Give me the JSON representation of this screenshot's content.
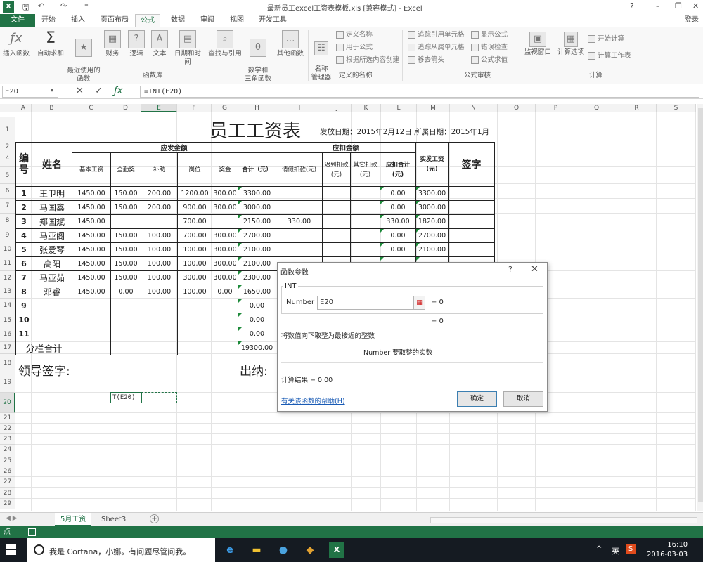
{
  "titlebar": {
    "file_title": "最新员工excel工资表模板.xls  [兼容模式] - Excel",
    "win_help": "?",
    "win_minimize": "–",
    "win_restore": "❐",
    "win_close": "✕"
  },
  "tabs": [
    "文件",
    "开始",
    "插入",
    "页面布局",
    "公式",
    "数据",
    "审阅",
    "视图",
    "开发工具"
  ],
  "active_tab": "公式",
  "login": "登录",
  "ribbon": {
    "fx_label": "插入函数",
    "autosum": "自动求和",
    "recent": "最近使用的\n函数",
    "finance": "财务",
    "logic": "逻辑",
    "text": "文本",
    "datetime": "日期和时间",
    "lookup": "查找与引用",
    "math": "数学和\n三角函数",
    "more": "其他函数",
    "group_lib": "函数库",
    "name_mgr": "名称\n管理器",
    "define_name": "定义名称",
    "use_formula": "用于公式",
    "create_sel": "根据所选内容创建",
    "group_names": "定义的名称",
    "trace_prec": "追踪引用单元格",
    "trace_dep": "追踪从属单元格",
    "remove_arrows": "移去箭头",
    "show_formulas": "显示公式",
    "error_check": "错误检查",
    "eval_formula": "公式求值",
    "watch": "监视窗口",
    "group_audit": "公式审核",
    "calc_options": "计算选项",
    "calc_now": "开始计算",
    "calc_sheet": "计算工作表",
    "group_calc": "计算"
  },
  "formula_bar": {
    "name_box": "E20",
    "formula": "=INT(E20)"
  },
  "columns": [
    "A",
    "B",
    "C",
    "D",
    "E",
    "F",
    "G",
    "H",
    "I",
    "J",
    "K",
    "L",
    "M",
    "N",
    "O",
    "P",
    "Q",
    "R",
    "S"
  ],
  "rows": [
    "1",
    "2",
    "4",
    "5",
    "6",
    "7",
    "8",
    "9",
    "10",
    "11",
    "12",
    "13",
    "14",
    "15",
    "16",
    "17",
    "18",
    "19",
    "20",
    "21",
    "22",
    "23",
    "24",
    "25",
    "26",
    "27",
    "28",
    "29"
  ],
  "sheet": {
    "title": "员工工资表",
    "issue_info": "发放日期：2015年2月12日 所属日期：2015年1月",
    "h_no": "编号",
    "h_name": "姓名",
    "h_pay": "应发金额",
    "h_deduct": "应扣金额",
    "h_net": "实发工资(元)",
    "h_sign": "签字",
    "h_base": "基本工资",
    "h_attend": "全勤奖",
    "h_subsidy": "补助",
    "h_post": "岗位",
    "h_bonus": "奖金",
    "h_total": "合计（元）",
    "h_leave": "请假扣款(元)",
    "h_late": "迟到扣款(元)",
    "h_other": "其它扣款(元)",
    "h_deduct_total": "应扣合计(元)",
    "employees": [
      {
        "no": "1",
        "name": "王卫明",
        "base": "1450.00",
        "attend": "150.00",
        "subsidy": "200.00",
        "post": "1200.00",
        "bonus": "300.00",
        "total": "3300.00",
        "leave": "",
        "late": "",
        "other": "",
        "dtotal": "0.00",
        "net": "3300.00"
      },
      {
        "no": "2",
        "name": "马国鑫",
        "base": "1450.00",
        "attend": "150.00",
        "subsidy": "200.00",
        "post": "900.00",
        "bonus": "300.00",
        "total": "3000.00",
        "leave": "",
        "late": "",
        "other": "",
        "dtotal": "0.00",
        "net": "3000.00"
      },
      {
        "no": "3",
        "name": "郑国斌",
        "base": "1450.00",
        "attend": "",
        "subsidy": "",
        "post": "700.00",
        "bonus": "",
        "total": "2150.00",
        "leave": "330.00",
        "late": "",
        "other": "",
        "dtotal": "330.00",
        "net": "1820.00"
      },
      {
        "no": "4",
        "name": "马亚阁",
        "base": "1450.00",
        "attend": "150.00",
        "subsidy": "100.00",
        "post": "700.00",
        "bonus": "300.00",
        "total": "2700.00",
        "leave": "",
        "late": "",
        "other": "",
        "dtotal": "0.00",
        "net": "2700.00"
      },
      {
        "no": "5",
        "name": "张爱琴",
        "base": "1450.00",
        "attend": "150.00",
        "subsidy": "100.00",
        "post": "100.00",
        "bonus": "300.00",
        "total": "2100.00",
        "leave": "",
        "late": "",
        "other": "",
        "dtotal": "0.00",
        "net": "2100.00"
      },
      {
        "no": "6",
        "name": "高阳",
        "base": "1450.00",
        "attend": "150.00",
        "subsidy": "100.00",
        "post": "100.00",
        "bonus": "300.00",
        "total": "2100.00",
        "leave": "",
        "late": "",
        "other": "",
        "dtotal": "",
        "net": ""
      },
      {
        "no": "7",
        "name": "马亚茹",
        "base": "1450.00",
        "attend": "150.00",
        "subsidy": "100.00",
        "post": "300.00",
        "bonus": "300.00",
        "total": "2300.00",
        "leave": "",
        "late": "",
        "other": "",
        "dtotal": "",
        "net": ""
      },
      {
        "no": "8",
        "name": "邓睿",
        "base": "1450.00",
        "attend": "0.00",
        "subsidy": "100.00",
        "post": "100.00",
        "bonus": "0.00",
        "total": "1650.00",
        "leave": "",
        "late": "",
        "other": "",
        "dtotal": "",
        "net": ""
      },
      {
        "no": "9",
        "name": "",
        "base": "",
        "attend": "",
        "subsidy": "",
        "post": "",
        "bonus": "",
        "total": "0.00",
        "leave": "",
        "late": "",
        "other": "",
        "dtotal": "",
        "net": ""
      },
      {
        "no": "10",
        "name": "",
        "base": "",
        "attend": "",
        "subsidy": "",
        "post": "",
        "bonus": "",
        "total": "0.00",
        "leave": "",
        "late": "",
        "other": "",
        "dtotal": "",
        "net": ""
      },
      {
        "no": "11",
        "name": "",
        "base": "",
        "attend": "",
        "subsidy": "",
        "post": "",
        "bonus": "",
        "total": "0.00",
        "leave": "",
        "late": "",
        "other": "",
        "dtotal": "",
        "net": ""
      }
    ],
    "subtotal_label": "分栏合计",
    "subtotal_value": "19300.00",
    "leader_sign": "领导签字:",
    "cashier": "出纳:",
    "editing_text": "T(E20)"
  },
  "dialog": {
    "title": "函数参数",
    "help_q": "?",
    "close": "✕",
    "function_name": "INT",
    "arg_label": "Number",
    "arg_value": "E20",
    "arg_result": "=  0",
    "func_result": "=  0",
    "description": "将数值向下取整为最接近的整数",
    "arg_desc": "Number  要取整的实数",
    "calc_result": "计算结果 =   0.00",
    "help_link": "有关该函数的帮助(H)",
    "ok": "确定",
    "cancel": "取消"
  },
  "sheet_tabs": [
    "5月工资",
    "Sheet3"
  ],
  "active_sheet": "5月工资",
  "status": "点",
  "taskbar": {
    "cortana": "我是 Cortana，小娜。有问题尽管问我。",
    "ime": "英",
    "time": "16:10",
    "date": "2016-03-03"
  }
}
